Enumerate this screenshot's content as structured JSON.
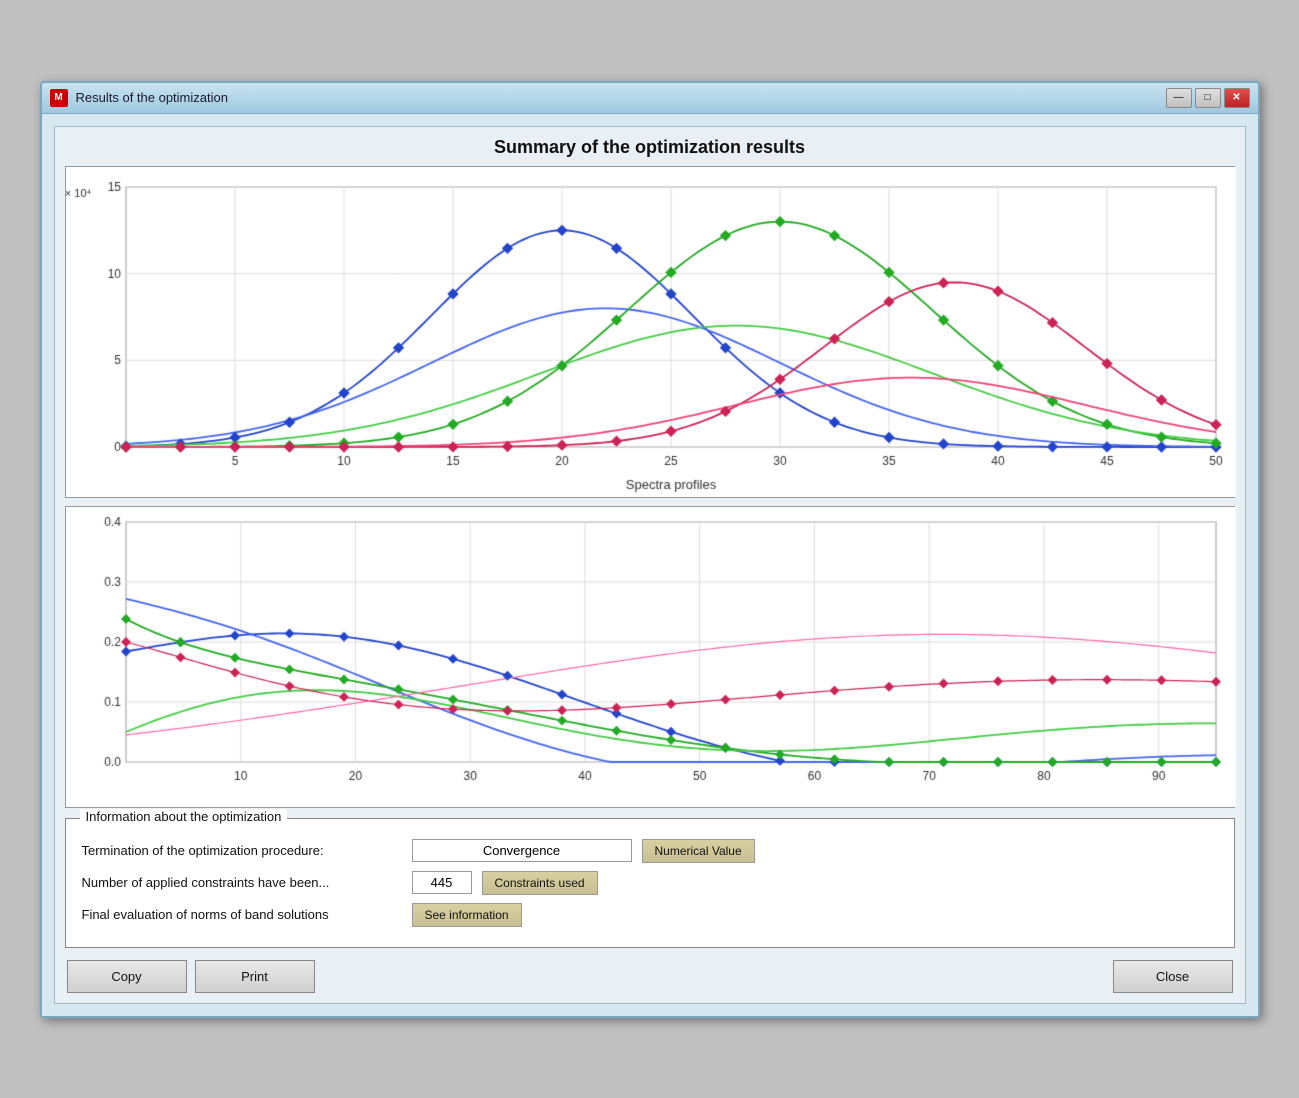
{
  "window": {
    "title": "Results of the optimization",
    "icon_label": "M"
  },
  "title_buttons": {
    "minimize": "—",
    "maximize": "□",
    "close": "✕"
  },
  "chart": {
    "title": "Summary of the optimization results",
    "top_chart": {
      "y_label": "× 10⁴",
      "y_max": 15,
      "x_label": "Spectra profiles",
      "x_min": 0,
      "x_max": 50
    },
    "bottom_chart": {
      "y_max": 0.4,
      "x_max": 90
    }
  },
  "info": {
    "section_label": "Information about the optimization",
    "rows": [
      {
        "label": "Termination of the optimization procedure:",
        "input_value": "Convergence",
        "input_type": "wide",
        "button_label": "Numerical Value"
      },
      {
        "label": "Number of applied constraints have been...",
        "input_value": "445",
        "input_type": "narrow",
        "button_label": "Constraints used"
      },
      {
        "label": "Final evaluation of norms of band solutions",
        "input_value": null,
        "input_type": null,
        "button_label": "See information"
      }
    ]
  },
  "buttons": {
    "copy": "Copy",
    "print": "Print",
    "close": "Close"
  }
}
